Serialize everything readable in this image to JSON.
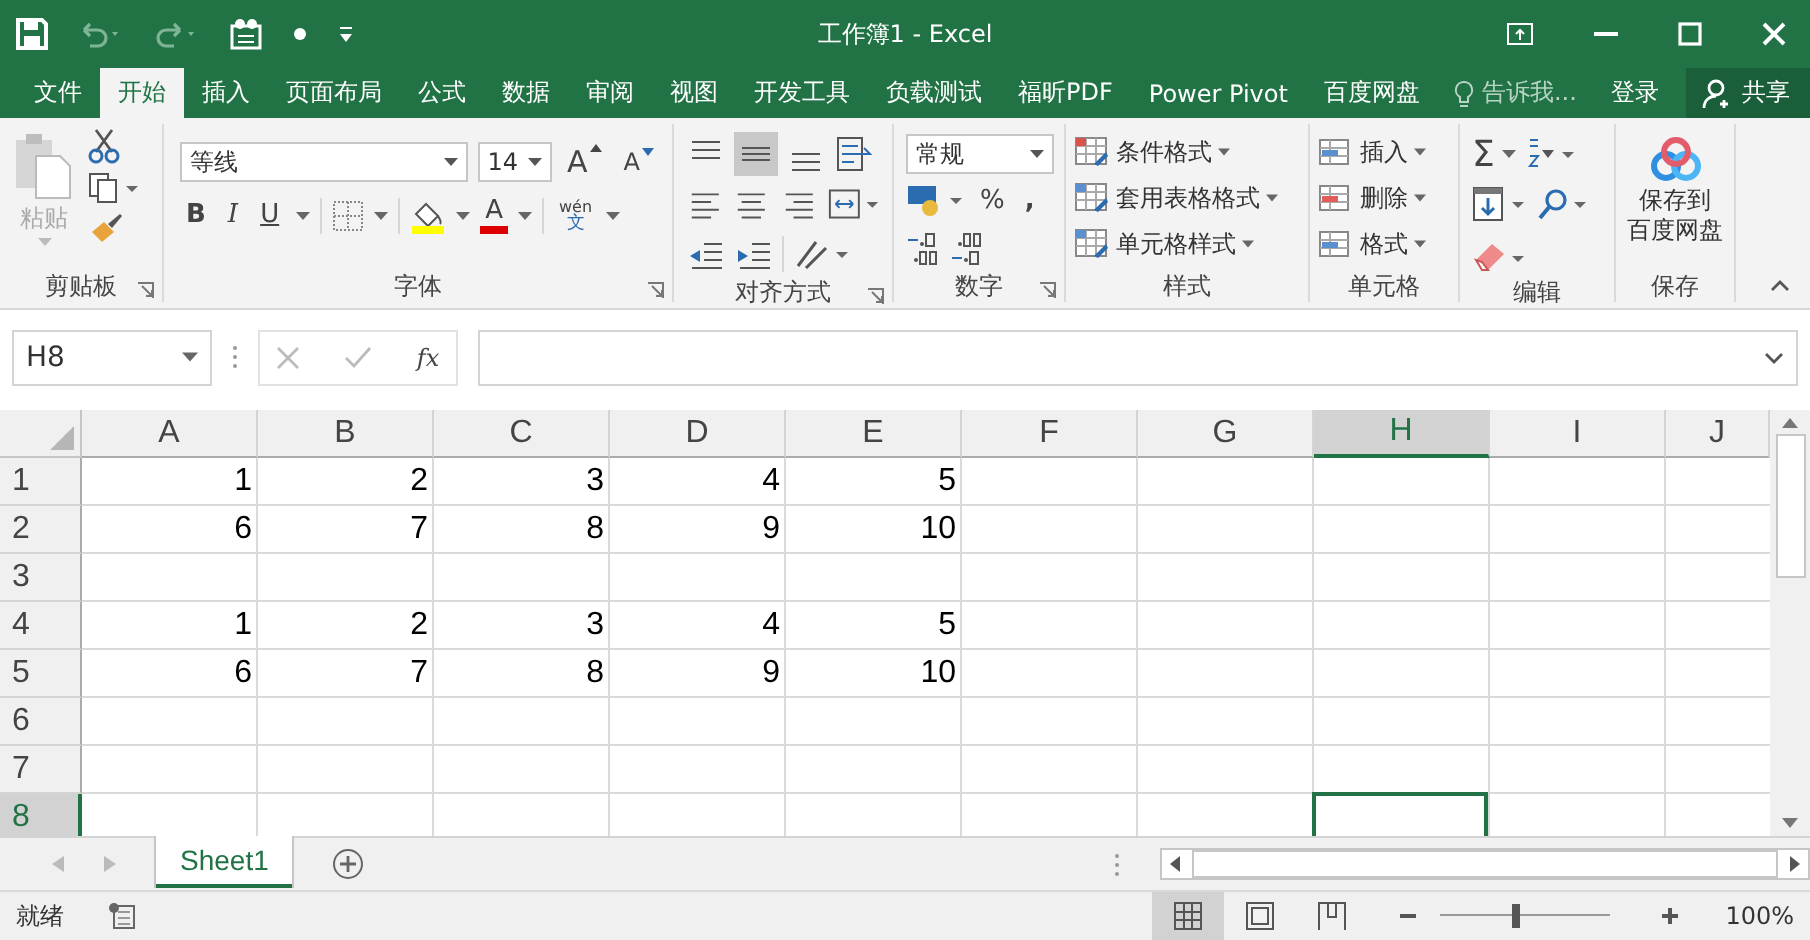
{
  "window": {
    "title": "工作簿1 - Excel"
  },
  "tabs": [
    {
      "label": "文件",
      "selected": false
    },
    {
      "label": "开始",
      "selected": true
    },
    {
      "label": "插入",
      "selected": false
    },
    {
      "label": "页面布局",
      "selected": false
    },
    {
      "label": "公式",
      "selected": false
    },
    {
      "label": "数据",
      "selected": false
    },
    {
      "label": "审阅",
      "selected": false
    },
    {
      "label": "视图",
      "selected": false
    },
    {
      "label": "开发工具",
      "selected": false
    },
    {
      "label": "负载测试",
      "selected": false
    },
    {
      "label": "福昕PDF",
      "selected": false
    },
    {
      "label": "Power Pivot",
      "selected": false
    },
    {
      "label": "百度网盘",
      "selected": false
    }
  ],
  "tell_me": {
    "placeholder": "告诉我..."
  },
  "sign_in": "登录",
  "share": "共享",
  "ribbon": {
    "clipboard": {
      "paste": "粘贴",
      "label": "剪贴板"
    },
    "font": {
      "name": "等线",
      "size": "14",
      "grow": "A",
      "shrink": "A",
      "bold": "B",
      "italic": "I",
      "underline": "U",
      "font_color": "A",
      "phonetic": "wén",
      "phonetic_char": "文",
      "label": "字体"
    },
    "alignment": {
      "label": "对齐方式"
    },
    "number": {
      "format": "常规",
      "percent": "%",
      "comma": ",",
      "label": "数字"
    },
    "styles": {
      "items": [
        "条件格式",
        "套用表格格式",
        "单元格样式"
      ],
      "label": "样式"
    },
    "cells": {
      "items": [
        "插入",
        "删除",
        "格式"
      ],
      "label": "单元格"
    },
    "editing": {
      "sum": "Σ",
      "label": "编辑"
    },
    "save": {
      "lines": [
        "保存到",
        "百度网盘"
      ],
      "label": "保存"
    }
  },
  "formula_bar": {
    "name_box": "H8",
    "fx": "fx"
  },
  "columns": [
    {
      "label": "A",
      "selected": false
    },
    {
      "label": "B",
      "selected": false
    },
    {
      "label": "C",
      "selected": false
    },
    {
      "label": "D",
      "selected": false
    },
    {
      "label": "E",
      "selected": false
    },
    {
      "label": "F",
      "selected": false
    },
    {
      "label": "G",
      "selected": false
    },
    {
      "label": "H",
      "selected": true
    },
    {
      "label": "I",
      "selected": false
    },
    {
      "label": "J",
      "selected": false
    }
  ],
  "rows": [
    {
      "label": "1",
      "selected": false,
      "cells": [
        "1",
        "2",
        "3",
        "4",
        "5"
      ]
    },
    {
      "label": "2",
      "selected": false,
      "cells": [
        "6",
        "7",
        "8",
        "9",
        "10"
      ]
    },
    {
      "label": "3",
      "selected": false
    },
    {
      "label": "4",
      "selected": false,
      "cells": [
        "1",
        "2",
        "3",
        "4",
        "5"
      ]
    },
    {
      "label": "5",
      "selected": false,
      "cells": [
        "6",
        "7",
        "8",
        "9",
        "10"
      ]
    },
    {
      "label": "6",
      "selected": false
    },
    {
      "label": "7",
      "selected": false
    },
    {
      "label": "8",
      "selected": true
    }
  ],
  "sheets": [
    {
      "name": "Sheet1",
      "selected": true
    }
  ],
  "status_bar": {
    "status": "就绪",
    "views": [
      {
        "kind": "normal",
        "selected": true
      },
      {
        "kind": "page_layout",
        "selected": false
      },
      {
        "kind": "page_break",
        "selected": false
      }
    ],
    "zoom": {
      "level": 0.45,
      "reading": "100%"
    }
  }
}
